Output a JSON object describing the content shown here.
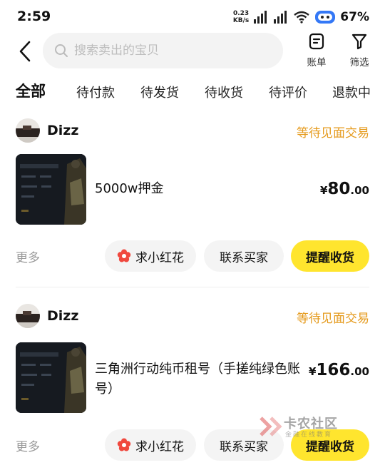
{
  "status_bar": {
    "time": "2:59",
    "net_speed_value": "0.23",
    "net_speed_unit": "KB/s",
    "battery": "67%",
    "colors": {
      "text": "#111111"
    }
  },
  "header": {
    "search_placeholder": "搜索卖出的宝贝",
    "bill_label": "账单",
    "filter_label": "筛选"
  },
  "tabs": [
    {
      "label": "全部",
      "active": true
    },
    {
      "label": "待付款",
      "active": false
    },
    {
      "label": "待发货",
      "active": false
    },
    {
      "label": "待收货",
      "active": false
    },
    {
      "label": "待评价",
      "active": false
    },
    {
      "label": "退款中",
      "active": false
    }
  ],
  "orders": [
    {
      "seller": "Dizz",
      "status": "等待见面交易",
      "title": "5000w押金",
      "price_symbol": "¥",
      "price_int": "80",
      "price_dec": ".00",
      "more": "更多",
      "btn_flower": "求小红花",
      "btn_contact": "联系买家",
      "btn_remind": "提醒收货"
    },
    {
      "seller": "Dizz",
      "status": "等待见面交易",
      "title": "三角洲行动纯币租号（手搓纯绿色账号）",
      "price_symbol": "¥",
      "price_int": "166",
      "price_dec": ".00",
      "more": "更多",
      "btn_flower": "求小红花",
      "btn_contact": "联系买家",
      "btn_remind": "提醒收货"
    }
  ],
  "watermark": {
    "text": "卡农社区",
    "subtext": "金融在线教育"
  },
  "colors": {
    "accent_yellow": "#ffe52e",
    "status_orange": "#e59a1c",
    "pill_gray": "#f4f4f4",
    "flower_red": "#f0483e"
  }
}
